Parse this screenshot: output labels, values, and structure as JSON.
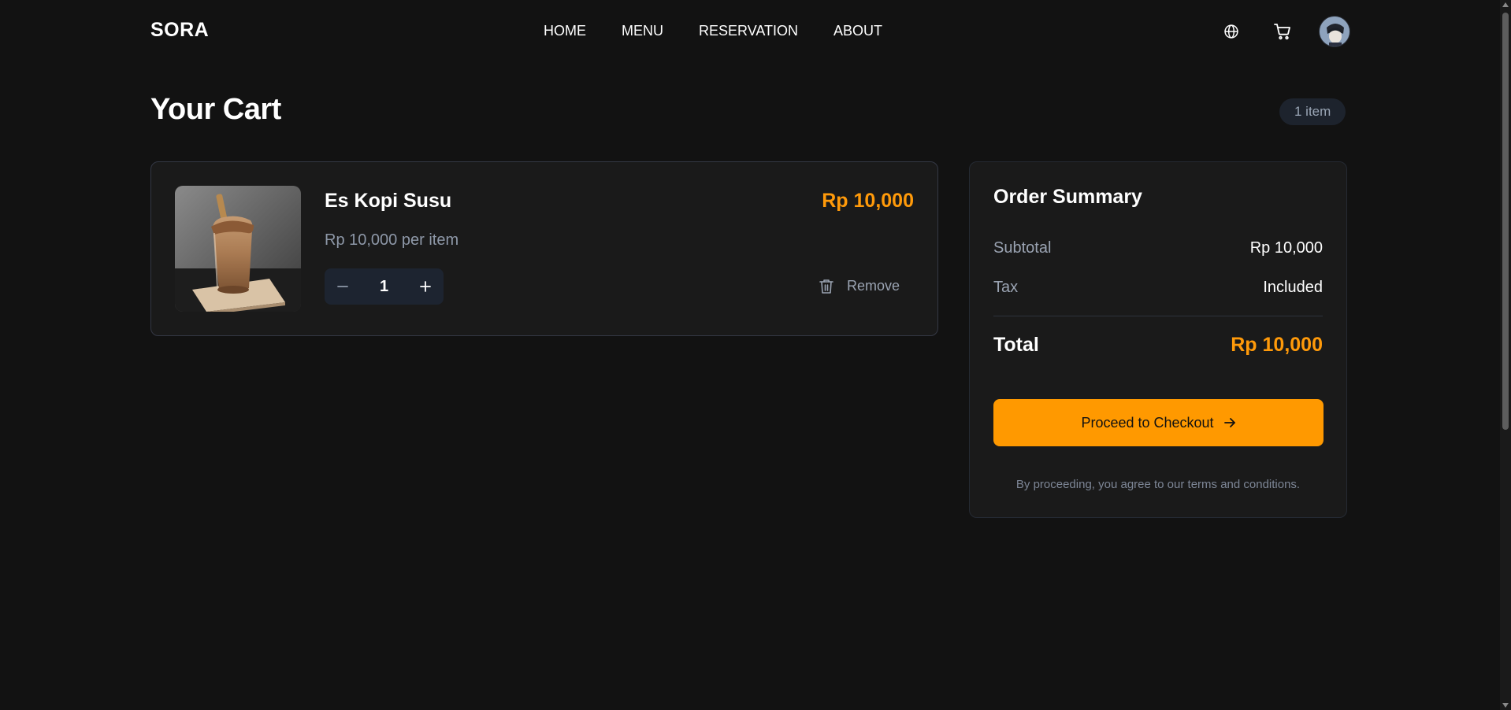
{
  "colors": {
    "background": "#121212",
    "card": "#1a1a1a",
    "accent": "#ff9900",
    "price": "#ff9a0a",
    "muted_text": "#9aa3b2"
  },
  "header": {
    "logo": "SORA",
    "nav": [
      "HOME",
      "MENU",
      "RESERVATION",
      "ABOUT"
    ],
    "icons": [
      "globe-icon",
      "cart-icon",
      "avatar"
    ]
  },
  "cart": {
    "title": "Your Cart",
    "item_count": "1 item",
    "items": [
      {
        "name": "Es Kopi Susu",
        "image_icon": "iced-coffee-glass-image",
        "unit_price": "Rp 10,000 per item",
        "line_total": "Rp 10,000",
        "quantity": "1",
        "remove_label": "Remove"
      }
    ]
  },
  "summary": {
    "title": "Order Summary",
    "subtotal_label": "Subtotal",
    "subtotal_value": "Rp 10,000",
    "tax_label": "Tax",
    "tax_value": "Included",
    "total_label": "Total",
    "total_value": "Rp 10,000",
    "checkout_label": "Proceed to Checkout",
    "terms_note": "By proceeding, you agree to our terms and conditions."
  }
}
